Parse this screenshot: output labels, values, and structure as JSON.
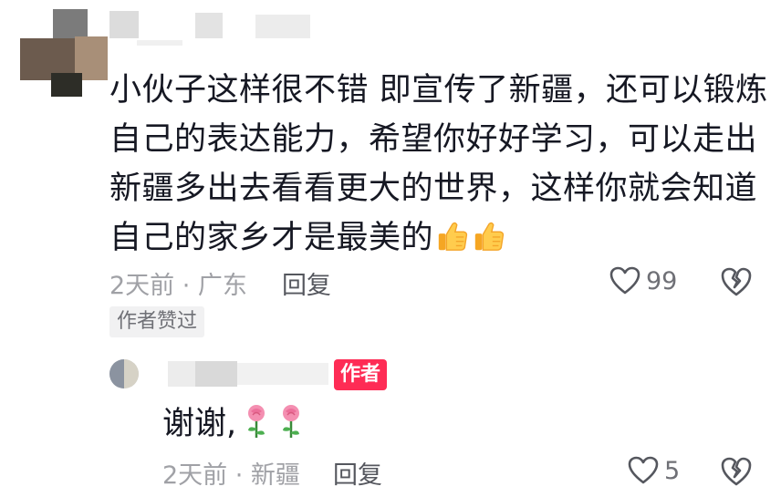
{
  "comment": {
    "lines": [
      "小伙子这样很不错 即宣传了新疆，还可以锻炼",
      "自己的表达能力，希望你好好学习，可以走出",
      "新疆多出去看看更大的世界，这样你就会知道",
      "自己的家乡才是最美的"
    ],
    "time_location": "2天前 · 广东",
    "reply_label": "回复",
    "like_count": "99",
    "author_liked_tag": "作者赞过"
  },
  "reply": {
    "author_badge": "作者",
    "text": "谢谢,",
    "time_location": "2天前 · 新疆",
    "reply_label": "回复",
    "like_count": "5"
  },
  "icons": {
    "thumbs_up": "thumbs-up-emoji",
    "rose": "rose-emoji",
    "like": "heart-outline-icon",
    "dislike": "broken-heart-icon"
  },
  "colors": {
    "text_primary": "#161823",
    "text_secondary": "#a0a1a6",
    "reply_link": "#55575e",
    "author_badge_bg": "#fe2c55",
    "tag_bg": "#f1f1f2"
  }
}
